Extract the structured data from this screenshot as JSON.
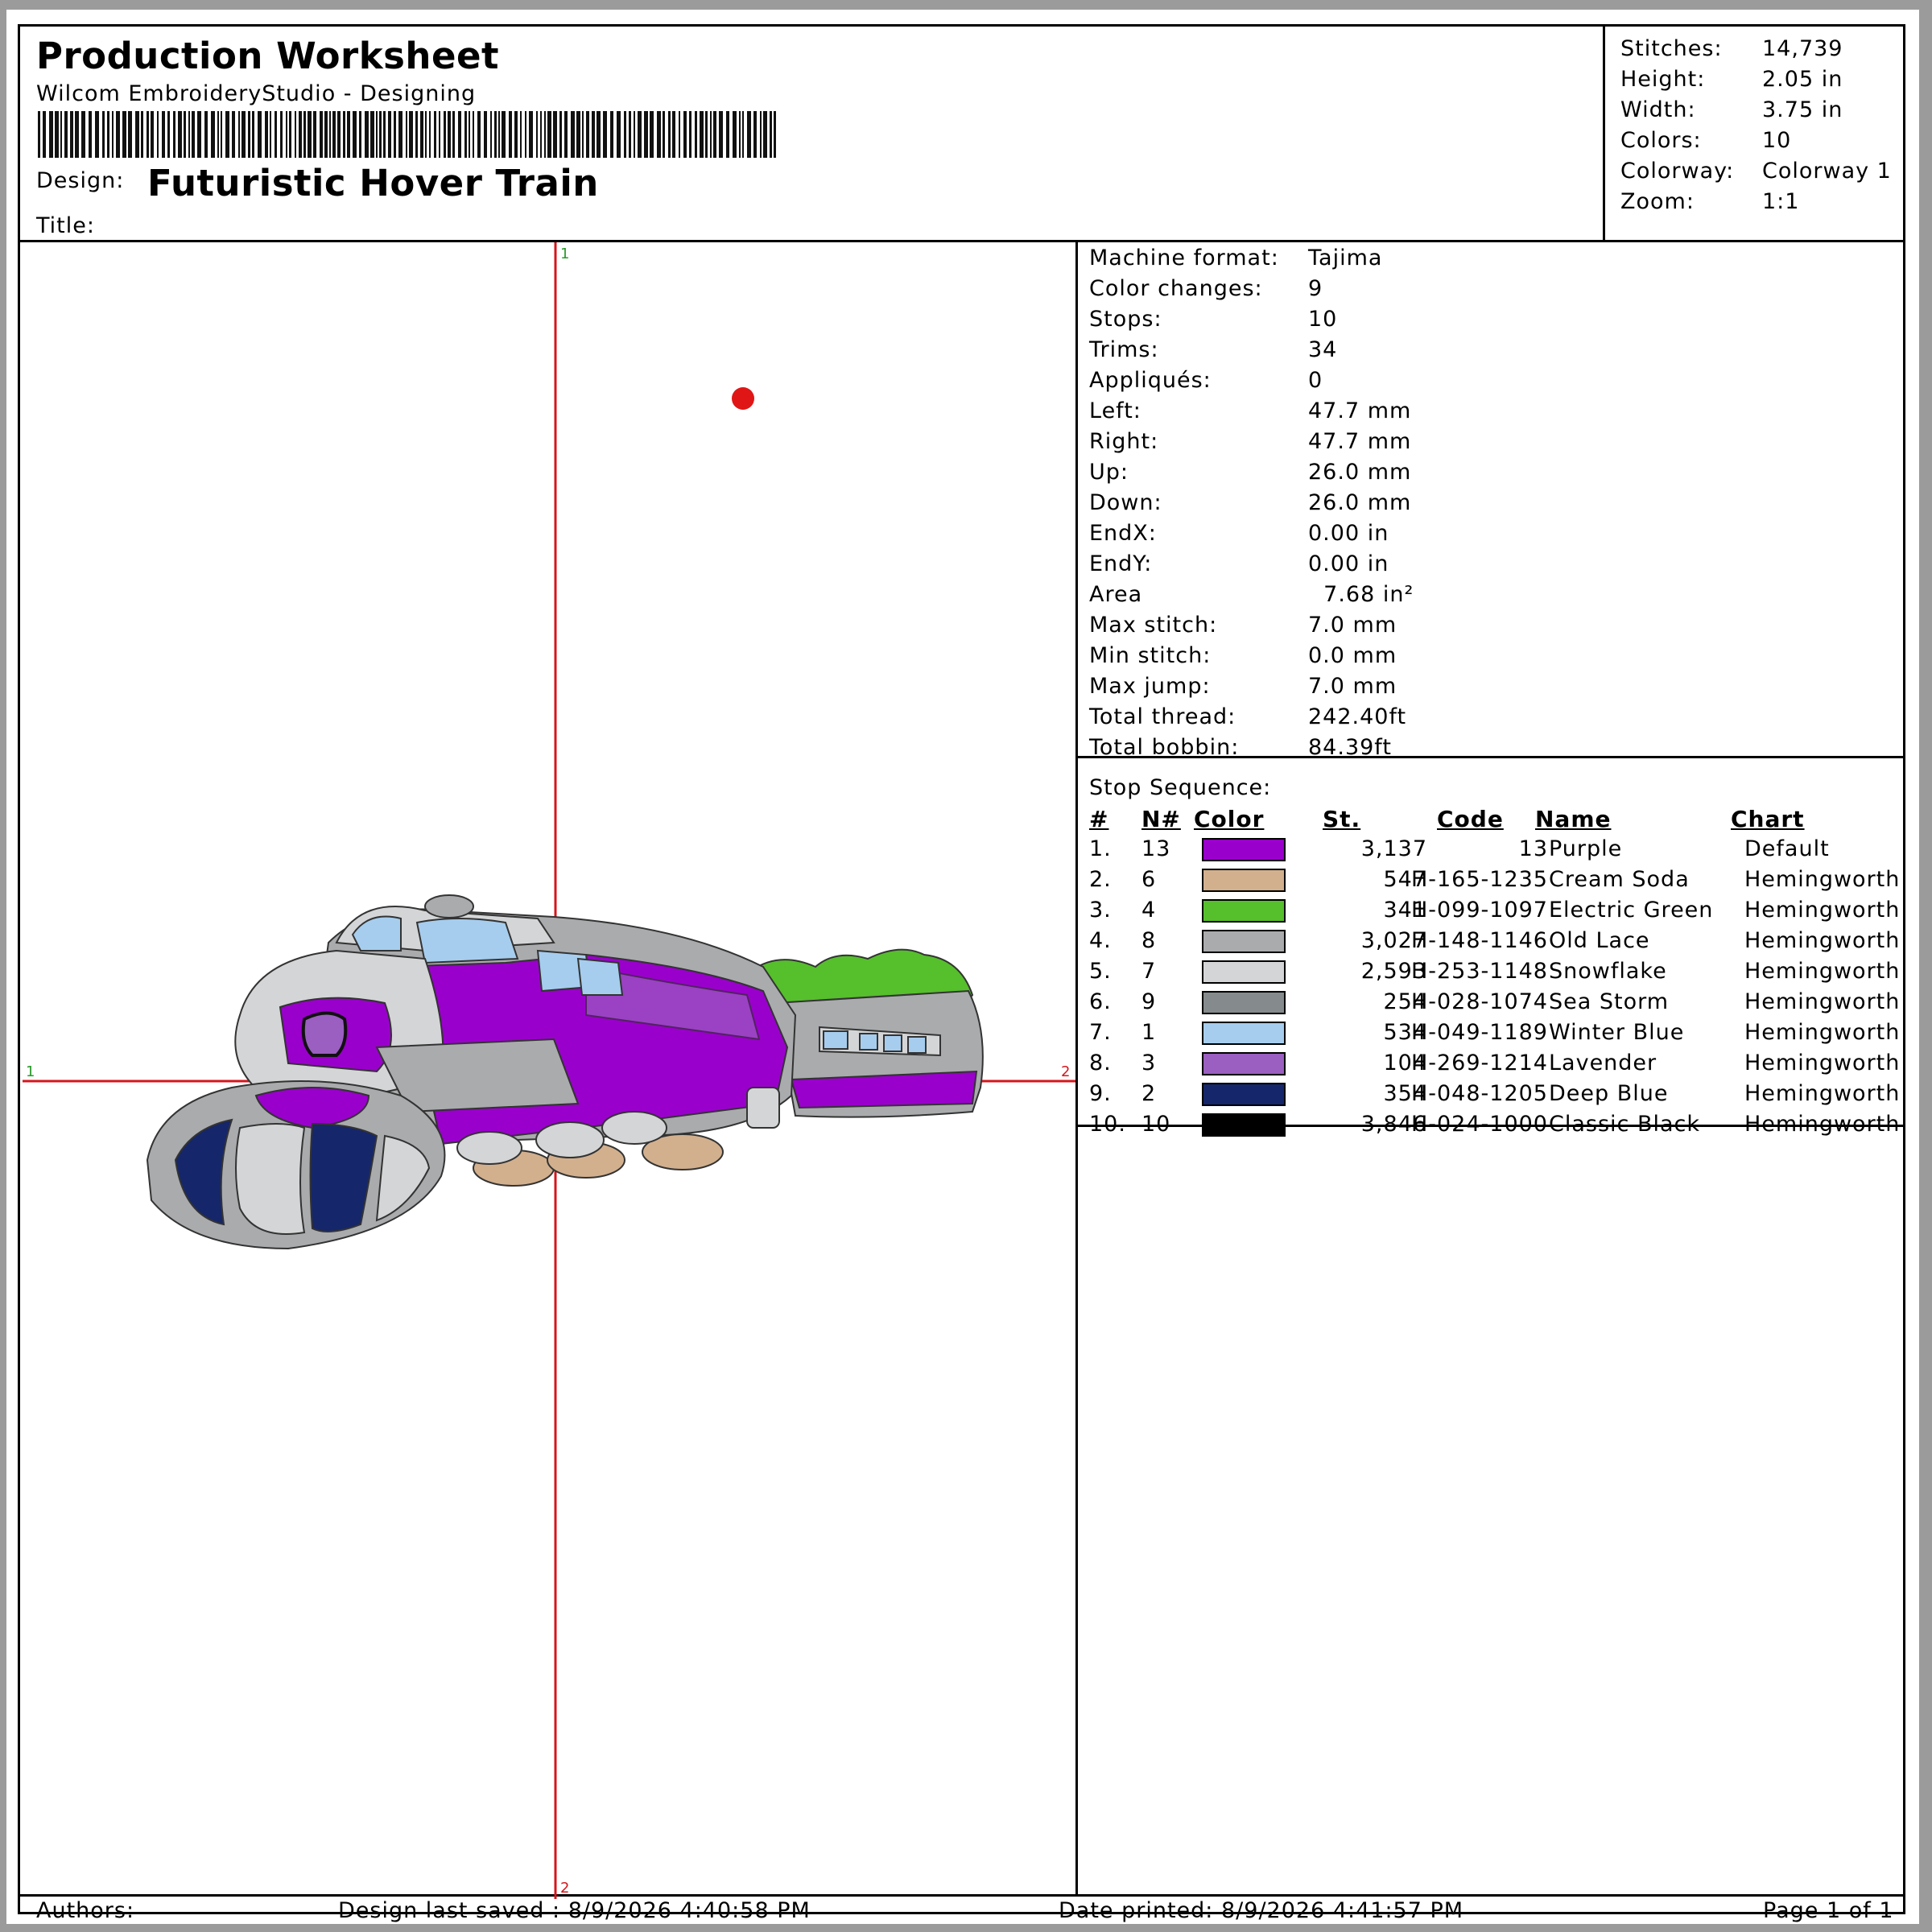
{
  "header": {
    "title": "Production Worksheet",
    "subtitle": "Wilcom EmbroideryStudio - Designing",
    "design_label": "Design:",
    "design_name": "Futuristic Hover Train",
    "title_label": "Title:"
  },
  "summary": [
    {
      "label": "Stitches:",
      "value": "14,739"
    },
    {
      "label": "Height:",
      "value": "2.05 in"
    },
    {
      "label": "Width:",
      "value": "3.75 in"
    },
    {
      "label": "Colors:",
      "value": "10"
    },
    {
      "label": "Colorway:",
      "value": "Colorway 1"
    },
    {
      "label": "Zoom:",
      "value": "1:1"
    }
  ],
  "specs": [
    {
      "label": "Machine format:",
      "value": "Tajima"
    },
    {
      "label": "Color changes:",
      "value": "9"
    },
    {
      "label": "Stops:",
      "value": "10"
    },
    {
      "label": "Trims:",
      "value": "34"
    },
    {
      "label": "Appliqués:",
      "value": "0"
    },
    {
      "label": "Left:",
      "value": "47.7 mm"
    },
    {
      "label": "Right:",
      "value": "47.7 mm"
    },
    {
      "label": "Up:",
      "value": "26.0 mm"
    },
    {
      "label": "Down:",
      "value": "26.0 mm"
    },
    {
      "label": "EndX:",
      "value": "0.00 in"
    },
    {
      "label": "EndY:",
      "value": "0.00 in"
    },
    {
      "label": "Area",
      "value": "  7.68 in²"
    },
    {
      "label": "Max stitch:",
      "value": "7.0 mm"
    },
    {
      "label": "Min stitch:",
      "value": "0.0 mm"
    },
    {
      "label": "Max jump:",
      "value": "7.0 mm"
    },
    {
      "label": "Total thread:",
      "value": "242.40ft"
    },
    {
      "label": "Total bobbin:",
      "value": "84.39ft"
    }
  ],
  "stop_sequence": {
    "title": "Stop Sequence:",
    "headers": {
      "num": "#",
      "needle": "N#",
      "color": "Color",
      "stitches": "St.",
      "code": "Code",
      "name": "Name",
      "chart": "Chart"
    },
    "rows": [
      {
        "num": "1.",
        "needle": "13",
        "color": "#9a00cc",
        "stitches": "3,137",
        "code": "13",
        "name": "Purple",
        "chart": "Default"
      },
      {
        "num": "2.",
        "needle": "6",
        "color": "#d2b08e",
        "stitches": "547",
        "code": "H-165-1235",
        "name": "Cream Soda",
        "chart": "Hemingworth"
      },
      {
        "num": "3.",
        "needle": "4",
        "color": "#56bf2c",
        "stitches": "341",
        "code": "H-099-1097",
        "name": "Electric Green",
        "chart": "Hemingworth"
      },
      {
        "num": "4.",
        "needle": "8",
        "color": "#a9abad",
        "stitches": "3,027",
        "code": "H-148-1146",
        "name": "Old Lace",
        "chart": "Hemingworth"
      },
      {
        "num": "5.",
        "needle": "7",
        "color": "#d4d5d6",
        "stitches": "2,593",
        "code": "H-253-1148",
        "name": "Snowflake",
        "chart": "Hemingworth"
      },
      {
        "num": "6.",
        "needle": "9",
        "color": "#858a8c",
        "stitches": "254",
        "code": "H-028-1074",
        "name": "Sea Storm",
        "chart": "Hemingworth"
      },
      {
        "num": "7.",
        "needle": "1",
        "color": "#a6cdee",
        "stitches": "534",
        "code": "H-049-1189",
        "name": "Winter Blue",
        "chart": "Hemingworth"
      },
      {
        "num": "8.",
        "needle": "3",
        "color": "#9a5fc0",
        "stitches": "104",
        "code": "H-269-1214",
        "name": "Lavender",
        "chart": "Hemingworth"
      },
      {
        "num": "9.",
        "needle": "2",
        "color": "#15266a",
        "stitches": "354",
        "code": "H-048-1205",
        "name": "Deep Blue",
        "chart": "Hemingworth"
      },
      {
        "num": "10.",
        "needle": "10",
        "color": "#000000",
        "stitches": "3,846",
        "code": "H-024-1000",
        "name": "Classic Black",
        "chart": "Hemingworth"
      }
    ]
  },
  "canvas": {
    "axis_top_label": "1",
    "axis_bottom_label": "2",
    "axis_left_label": "1",
    "axis_right_label": "2",
    "crosshair_color": "#d4161c",
    "axis_label_green": "#2a9a2a"
  },
  "footer": {
    "authors": "Authors:",
    "last_saved": "Design last saved : 8/9/2026 4:40:58 PM",
    "date_printed": "Date printed: 8/9/2026 4:41:57 PM",
    "page": "Page 1 of 1"
  }
}
